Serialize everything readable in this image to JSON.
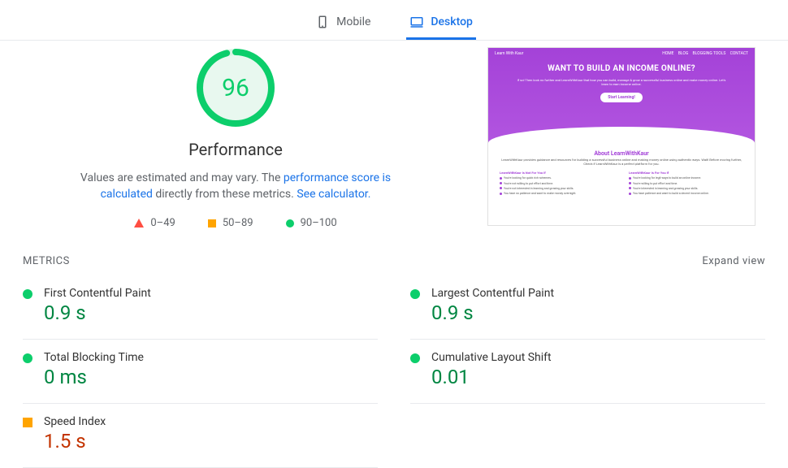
{
  "tabs": {
    "mobile": "Mobile",
    "desktop": "Desktop"
  },
  "gauge": {
    "score": "96",
    "label": "Performance",
    "desc_prefix": "Values are estimated and may vary. The ",
    "desc_link1": "performance score is calculated",
    "desc_mid": " directly from these metrics. ",
    "desc_link2": "See calculator."
  },
  "legend": {
    "r1": "0–49",
    "r2": "50–89",
    "r3": "90–100"
  },
  "thumb": {
    "logo": "Learn With Kaur",
    "nav": {
      "a": "HOME",
      "b": "BLOG",
      "c": "BLOGGING TOOLS",
      "d": "CONTACT"
    },
    "h1": "WANT TO BUILD AN INCOME ONLINE?",
    "sub": "If so! Then look no further and LearnWithKaur that how you can build, manage & grow a successful business online and make money online. Let's learn to earn income online.",
    "btn": "Start Learning!",
    "about_h": "About LearnWithKaur",
    "about_sub": "LearnWithKaur provides guidance and resources for building a successful business online and making money online using authentic ways. Wait! Before moving further, Check if LearnWithKaur is a perfect platform for you.",
    "col1_h": "LearnWithKaur Is Not For You If",
    "col1": {
      "a": "You're looking for quick rich schemes.",
      "b": "You're not willing to put effort and time.",
      "c": "You're not interested in learning and growing your skills.",
      "d": "You have no patience and want to make money overnight."
    },
    "col2_h": "LearnWithKaur Is For You If",
    "col2": {
      "a": "You're looking for legit ways to build an online income.",
      "b": "You're willing to put effort and time.",
      "c": "You're interested in learning and growing your skills.",
      "d": "You have patience and want to build a decent income online."
    }
  },
  "metrics_header": {
    "title": "METRICS",
    "expand": "Expand view"
  },
  "metrics": {
    "fcp": {
      "name": "First Contentful Paint",
      "val": "0.9 s"
    },
    "lcp": {
      "name": "Largest Contentful Paint",
      "val": "0.9 s"
    },
    "tbt": {
      "name": "Total Blocking Time",
      "val": "0 ms"
    },
    "cls": {
      "name": "Cumulative Layout Shift",
      "val": "0.01"
    },
    "si": {
      "name": "Speed Index",
      "val": "1.5 s"
    }
  }
}
